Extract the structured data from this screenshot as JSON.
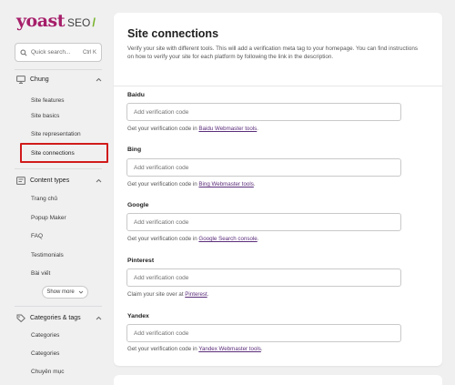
{
  "brand": {
    "name": "yoast",
    "product": "SEO"
  },
  "search": {
    "placeholder": "Quick search...",
    "shortcut": "Ctrl K"
  },
  "sidebar": {
    "groups": [
      {
        "label": "Chung",
        "items": [
          "Site features",
          "Site basics",
          "Site representation",
          "Site connections"
        ]
      },
      {
        "label": "Content types",
        "items": [
          "Trang chủ",
          "Popup Maker",
          "FAQ",
          "Testimonials",
          "Bài viết"
        ],
        "show_more": "Show more"
      },
      {
        "label": "Categories & tags",
        "items": [
          "Categories",
          "Categories",
          "Chuyên mục"
        ]
      }
    ],
    "active_item": "Site connections"
  },
  "main": {
    "title": "Site connections",
    "description": "Verify your site with different tools. This will add a verification meta tag to your homepage. You can find instructions on how to verify your site for each platform by following the link in the description.",
    "fields": [
      {
        "label": "Baidu",
        "placeholder": "Add verification code",
        "help_prefix": "Get your verification code in ",
        "link": "Baidu Webmaster tools",
        "help_suffix": "."
      },
      {
        "label": "Bing",
        "placeholder": "Add verification code",
        "help_prefix": "Get your verification code in ",
        "link": "Bing Webmaster tools",
        "help_suffix": "."
      },
      {
        "label": "Google",
        "placeholder": "Add verification code",
        "help_prefix": "Get your verification code in ",
        "link": "Google Search console",
        "help_suffix": "."
      },
      {
        "label": "Pinterest",
        "placeholder": "Add verification code",
        "help_prefix": "Claim your site over at ",
        "link": "Pinterest",
        "help_suffix": "."
      },
      {
        "label": "Yandex",
        "placeholder": "Add verification code",
        "help_prefix": "Get your verification code in ",
        "link": "Yandex Webmaster tools",
        "help_suffix": "."
      }
    ]
  },
  "colors": {
    "brand": "#a61e69",
    "highlight_border": "#d11a1a",
    "link": "#5b2d7a",
    "accent_green": "#77b227"
  }
}
